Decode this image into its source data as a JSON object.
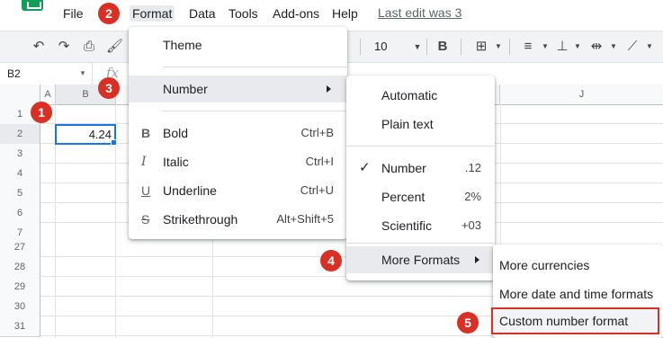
{
  "menubar": {
    "items": [
      "File",
      "Format",
      "Data",
      "Tools",
      "Add-ons",
      "Help"
    ],
    "last_edit": "Last edit was 3"
  },
  "toolbar": {
    "font_size": "10"
  },
  "formula": {
    "namebox": "B2",
    "fx": "fx"
  },
  "grid": {
    "columns": [
      "A",
      "B",
      "J"
    ],
    "rows": [
      "1",
      "2",
      "3",
      "4",
      "5",
      "6",
      "7",
      "27",
      "28",
      "29",
      "30",
      "31"
    ],
    "cell_b2": "4.24"
  },
  "format_menu": {
    "theme": "Theme",
    "number": "Number",
    "bold": "Bold",
    "bold_shortcut": "Ctrl+B",
    "italic": "Italic",
    "italic_shortcut": "Ctrl+I",
    "underline": "Underline",
    "underline_shortcut": "Ctrl+U",
    "strikethrough": "Strikethrough",
    "strikethrough_shortcut": "Alt+Shift+5"
  },
  "number_menu": {
    "automatic": "Automatic",
    "plain_text": "Plain text",
    "number": "Number",
    "number_example": ".12",
    "percent": "Percent",
    "percent_example": "2%",
    "scientific": "Scientific",
    "scientific_example": "+03",
    "more_formats": "More Formats"
  },
  "more_formats_menu": {
    "more_currencies": "More currencies",
    "more_date_time": "More date and time formats",
    "custom_number": "Custom number format"
  },
  "badges": [
    "1",
    "2",
    "3",
    "4",
    "5"
  ],
  "colors": {
    "badge": "#d93025",
    "highlight": "#e8eaed",
    "selection": "#1a73e8"
  }
}
